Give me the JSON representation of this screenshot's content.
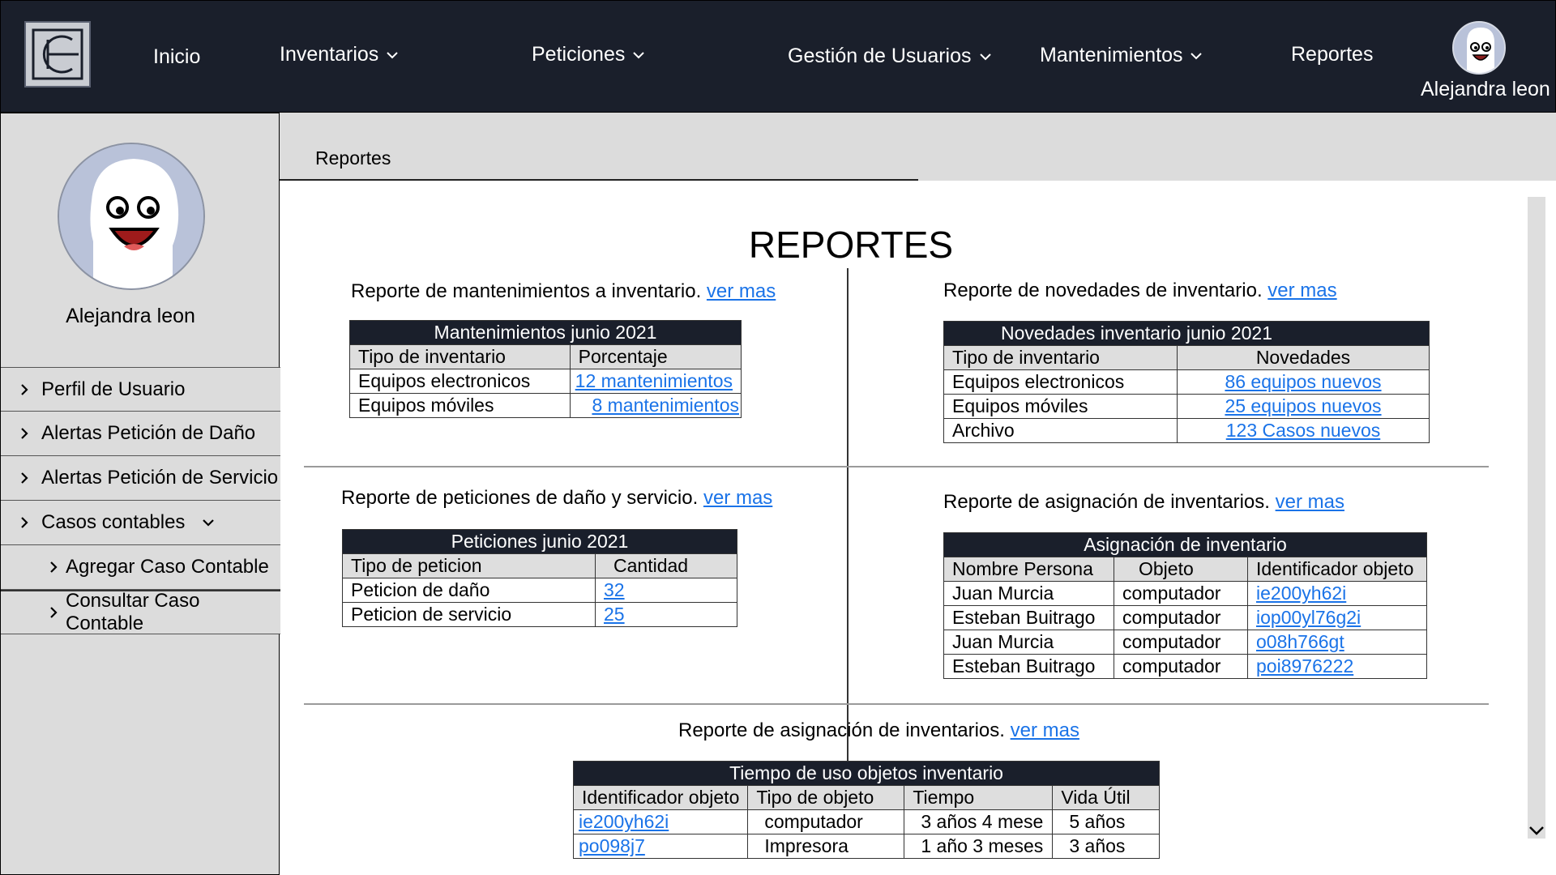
{
  "nav": {
    "items": [
      {
        "label": "Inicio",
        "dropdown": false
      },
      {
        "label": "Inventarios",
        "dropdown": true
      },
      {
        "label": "Peticiones",
        "dropdown": true
      },
      {
        "label": "Gestión de Usuarios",
        "dropdown": true
      },
      {
        "label": "Mantenimientos",
        "dropdown": true
      },
      {
        "label": "Reportes",
        "dropdown": false
      }
    ],
    "user_name": "Alejandra leon"
  },
  "sidebar": {
    "user_name": "Alejandra leon",
    "items": [
      {
        "label": "Perfil de Usuario"
      },
      {
        "label": "Alertas Petición de Daño"
      },
      {
        "label": "Alertas Petición de Servicio"
      },
      {
        "label": "Casos contables"
      },
      {
        "label": "Agregar Caso Contable"
      },
      {
        "label": "Consultar Caso Contable"
      }
    ]
  },
  "breadcrumb": "Reportes",
  "page_title": "REPORTES",
  "reports": {
    "mantenimientos": {
      "title": "Reporte de mantenimientos a inventario.",
      "link": "ver mas",
      "table_title": "Mantenimientos  junio 2021",
      "columns": [
        "Tipo de inventario",
        "Porcentaje"
      ],
      "rows": [
        [
          "Equipos electronicos",
          "12 mantenimientos"
        ],
        [
          "Equipos móviles",
          "8 mantenimientos"
        ]
      ]
    },
    "novedades": {
      "title": "Reporte de novedades de inventario.",
      "link": "ver mas",
      "table_title": "Novedades inventario junio 2021",
      "columns": [
        "Tipo de inventario",
        "Novedades"
      ],
      "rows": [
        [
          "Equipos electronicos",
          "86 equipos nuevos"
        ],
        [
          "Equipos móviles",
          "25 equipos nuevos"
        ],
        [
          "Archivo",
          "123 Casos  nuevos"
        ]
      ]
    },
    "peticiones": {
      "title": "Reporte de peticiones de daño y servicio.",
      "link": "ver mas",
      "table_title": "Peticiones junio 2021",
      "columns": [
        "Tipo de peticion",
        "Cantidad"
      ],
      "rows": [
        [
          "Peticion de daño",
          "32"
        ],
        [
          "Peticion de servicio",
          "25"
        ]
      ]
    },
    "asignacion": {
      "title": "Reporte de asignación de inventarios.",
      "link": "ver mas",
      "table_title": "Asignación de inventario",
      "columns": [
        "Nombre Persona",
        "Objeto",
        "Identificador objeto"
      ],
      "rows": [
        [
          "Juan Murcia",
          "computador",
          "ie200yh62i"
        ],
        [
          "Esteban Buitrago",
          "computador",
          "iop00yl76g2i"
        ],
        [
          "Juan Murcia",
          "computador",
          "o08h766gt"
        ],
        [
          "Esteban Buitrago",
          "computador",
          "poi8976222"
        ]
      ]
    },
    "tiempo_uso": {
      "title": "Reporte de asignación de inventarios.",
      "link": "ver mas",
      "table_title": "Tiempo de uso objetos inventario",
      "columns": [
        "Identificador objeto",
        "Tipo de objeto",
        "Tiempo",
        "Vida Útil"
      ],
      "rows": [
        [
          "ie200yh62i",
          "computador",
          "3 años 4 mese",
          "5 años"
        ],
        [
          "po098j7",
          "Impresora",
          "1 año 3 meses",
          "3 años"
        ]
      ]
    }
  },
  "colors": {
    "nav_bg": "#1a1f2b",
    "sidebar_bg": "#dcdcdc",
    "link": "#1a73e8",
    "avatar_bg": "#b9c2d9"
  }
}
